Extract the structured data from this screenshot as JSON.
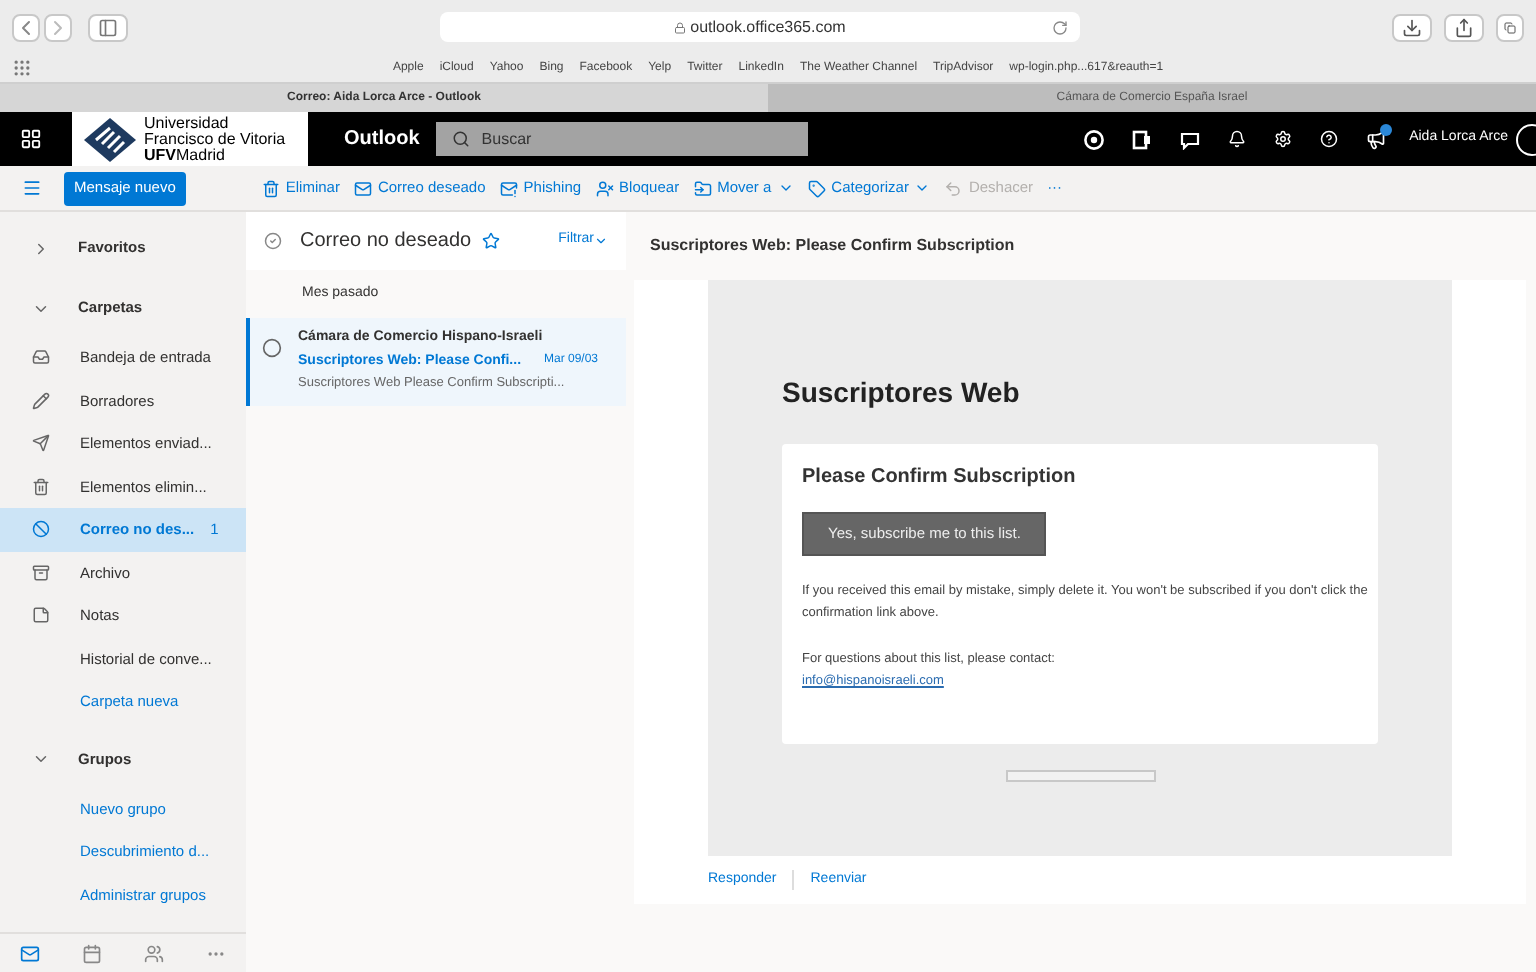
{
  "browser": {
    "address": "outlook.office365.com",
    "bookmarks": [
      "Apple",
      "iCloud",
      "Yahoo",
      "Bing",
      "Facebook",
      "Yelp",
      "Twitter",
      "LinkedIn",
      "The Weather Channel",
      "TripAdvisor",
      "wp-login.php...617&reauth=1"
    ],
    "tabs": [
      {
        "label": "Correo: Aida Lorca Arce - Outlook",
        "selected": true
      },
      {
        "label": "Cámara de Comercio España Israel",
        "selected": false
      }
    ]
  },
  "header": {
    "org_lines": [
      "Universidad",
      "Francisco de Vitoria"
    ],
    "org_bold": "UFV",
    "org_city": "Madrid",
    "app": "Outlook",
    "search": {
      "placeholder": "Buscar"
    },
    "user": "Aida Lorca Arce"
  },
  "new_message": "Mensaje nuevo",
  "commands": [
    {
      "label": "Eliminar",
      "kind": "trash",
      "dropdown": false,
      "disabled": false
    },
    {
      "label": "Correo deseado",
      "kind": "mail",
      "dropdown": false,
      "disabled": false
    },
    {
      "label": "Phishing",
      "kind": "warn",
      "dropdown": false,
      "disabled": false
    },
    {
      "label": "Bloquear",
      "kind": "block",
      "dropdown": false,
      "disabled": false
    },
    {
      "label": "Mover a",
      "kind": "move",
      "dropdown": true,
      "disabled": false
    },
    {
      "label": "Categorizar",
      "kind": "tag",
      "dropdown": true,
      "disabled": false
    },
    {
      "label": "Deshacer",
      "kind": "undo",
      "dropdown": false,
      "disabled": true
    },
    {
      "label": "···",
      "kind": "more",
      "dropdown": false,
      "disabled": false
    }
  ],
  "nav": [
    {
      "kind": "section",
      "label": "Favoritos",
      "expanded": false
    },
    {
      "kind": "section",
      "label": "Carpetas",
      "expanded": true
    },
    {
      "kind": "inbox",
      "label": "Bandeja de entrada",
      "selected": false
    },
    {
      "kind": "drafts",
      "label": "Borradores",
      "selected": false
    },
    {
      "kind": "sent",
      "label": "Elementos enviad...",
      "selected": false
    },
    {
      "kind": "deleted",
      "label": "Elementos elimin...",
      "selected": false
    },
    {
      "kind": "junk",
      "label": "Correo no des...",
      "count": "1",
      "selected": true
    },
    {
      "kind": "archive",
      "label": "Archivo",
      "selected": false
    },
    {
      "kind": "notes",
      "label": "Notas",
      "selected": false
    },
    {
      "kind": "plain",
      "label": "Historial de conve...",
      "selected": false
    },
    {
      "kind": "link",
      "label": "Carpeta nueva"
    },
    {
      "kind": "section",
      "label": "Grupos",
      "expanded": true
    },
    {
      "kind": "link",
      "label": "Nuevo grupo"
    },
    {
      "kind": "link",
      "label": "Descubrimiento d..."
    },
    {
      "kind": "link",
      "label": "Administrar grupos"
    }
  ],
  "bottom_apps": [
    {
      "kind": "mail",
      "selected": true
    },
    {
      "kind": "calendar",
      "selected": false
    },
    {
      "kind": "people",
      "selected": false
    },
    {
      "kind": "more",
      "selected": false
    }
  ],
  "list": {
    "title": "Correo no deseado",
    "filter": "Filtrar",
    "group": "Mes pasado",
    "messages": [
      {
        "sender": "Cámara de Comercio Hispano-Israeli",
        "subject": "Suscriptores Web: Please Confi...",
        "date": "Mar 09/03",
        "preview": "Suscriptores Web Please Confirm Subscripti...",
        "selected": true
      }
    ]
  },
  "reading": {
    "subject": "Suscriptores Web: Please Confirm Subscription",
    "heading": "Suscriptores Web",
    "card_title": "Please Confirm Subscription",
    "button": "Yes, subscribe me to this list.",
    "paragraph": "If you received this email by mistake, simply delete it. You won't be subscribed if you don't click the confirmation link above.",
    "contact": "For questions about this list, please contact:",
    "email": "info@hispanoisraeli.com",
    "actions": [
      "Responder",
      "Reenviar"
    ]
  }
}
